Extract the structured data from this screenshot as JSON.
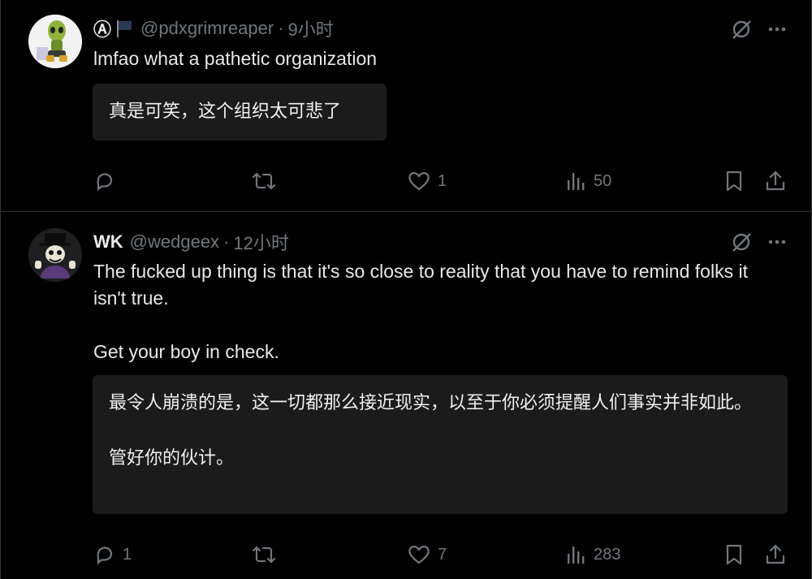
{
  "tweets": [
    {
      "display_name": "Ⓐ",
      "handle": "@pdxgrimreaper",
      "separator": "·",
      "time": "9小时",
      "text": "lmfao what a pathetic organization",
      "translation": "真是可笑，这个组织太可悲了",
      "actions": {
        "replies": "",
        "retweets": "",
        "likes": "1",
        "views": "50"
      }
    },
    {
      "display_name": "WK",
      "handle": "@wedgeex",
      "separator": "·",
      "time": "12小时",
      "text": "The fucked up thing is that it's so close to reality that you have to remind folks it isn't true.\n\nGet your boy in check.",
      "translation": "最令人崩溃的是，这一切都那么接近现实，以至于你必须提醒人们事实并非如此。\n\n管好你的伙计。",
      "actions": {
        "replies": "1",
        "retweets": "",
        "likes": "7",
        "views": "283"
      }
    }
  ],
  "colors": {
    "background": "#000000",
    "text_primary": "#e7e9ea",
    "text_secondary": "#71767b",
    "translation_bg": "#1c1b1b",
    "divider": "#2f3336"
  },
  "icons": {
    "grok": "grok-icon",
    "more": "more-icon",
    "reply": "reply-icon",
    "retweet": "retweet-icon",
    "like": "heart-icon",
    "views": "views-icon",
    "bookmark": "bookmark-icon",
    "share": "share-icon",
    "flag": "flag-icon"
  }
}
